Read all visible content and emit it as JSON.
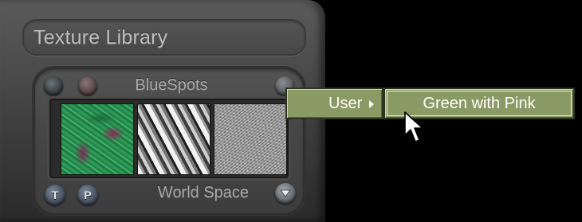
{
  "library": {
    "title": "Texture Library",
    "texture_name": "BlueSpots",
    "space_label": "World Space",
    "buttons": {
      "t_label": "T",
      "p_label": "P"
    },
    "textures": [
      {
        "icon": "green-pink-texture"
      },
      {
        "icon": "striped-texture"
      },
      {
        "icon": "stone-texture"
      }
    ]
  },
  "menu": {
    "user_label": "User",
    "submenu_item": "Green with Pink",
    "accent": "#8a9a64"
  }
}
